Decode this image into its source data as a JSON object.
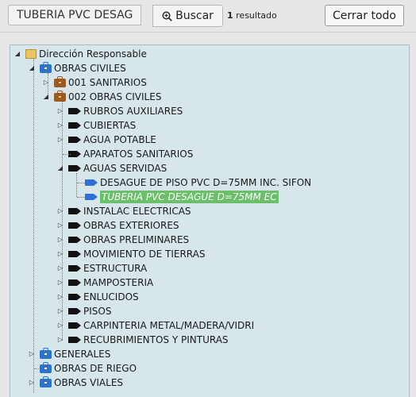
{
  "toolbar": {
    "search_value": "TUBERIA PVC DESAGUE",
    "search_button_label": "Buscar",
    "result_count_number": "1",
    "result_count_text": "resultado",
    "close_all_label": "Cerrar todo"
  },
  "tree": {
    "root_label": "Dirección Responsable",
    "obras_civiles": "OBRAS CIVILES",
    "sanitarios_001": "001 SANITARIOS",
    "obras_civiles_002": "002 OBRAS CIVILES",
    "items": [
      "RUBROS AUXILIARES",
      "CUBIERTAS",
      "AGUA POTABLE",
      "APARATOS SANITARIOS",
      "AGUAS SERVIDAS"
    ],
    "aguas_servidas_children": [
      "DESAGUE DE PISO PVC D=75MM INC. SIFON",
      "TUBERIA PVC DESAGUE D=75MM EC"
    ],
    "items_after": [
      "INSTALAC ELECTRICAS",
      "OBRAS EXTERIORES",
      "OBRAS PRELIMINARES",
      "MOVIMIENTO DE TIERRAS",
      "ESTRUCTURA",
      "MAMPOSTERIA",
      "ENLUCIDOS",
      "PISOS",
      "CARPINTERIA METAL/MADERA/VIDRI",
      "RECUBRIMIENTOS Y PINTURAS"
    ],
    "generales": "GENERALES",
    "obras_de_riego": "OBRAS DE RIEGO",
    "obras_viales": "OBRAS VIALES"
  }
}
